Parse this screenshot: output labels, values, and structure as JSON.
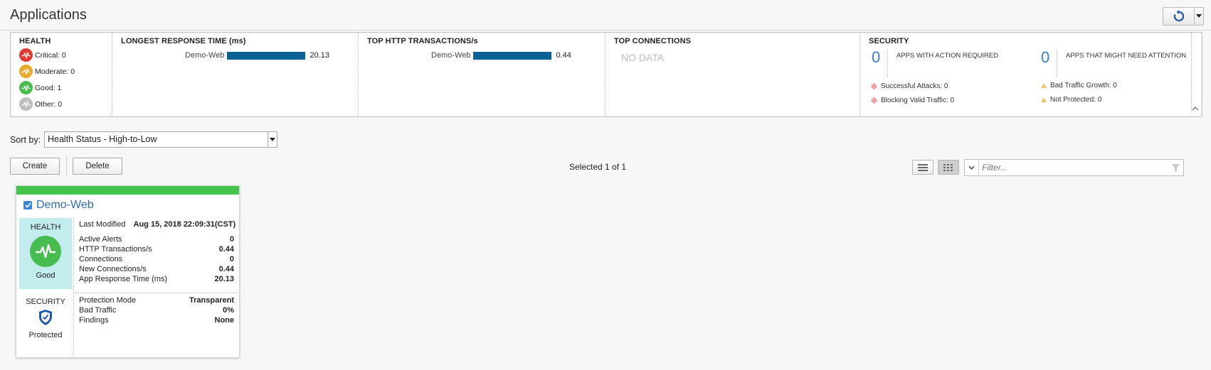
{
  "page": {
    "title": "Applications"
  },
  "summary": {
    "health": {
      "title": "HEALTH",
      "items": [
        {
          "label": "Critical: 0",
          "color": "#e03a33"
        },
        {
          "label": "Moderate: 0",
          "color": "#eaa92a"
        },
        {
          "label": "Good: 1",
          "color": "#47bd4f"
        },
        {
          "label": "Other: 0",
          "color": "#bdbdbd"
        }
      ]
    },
    "response": {
      "title": "LONGEST RESPONSE TIME (ms)",
      "label": "Demo-Web",
      "value": "20.13",
      "fraction": 1.0
    },
    "transactions": {
      "title": "TOP HTTP TRANSACTIONS/s",
      "label": "Demo-Web",
      "value": "0.44",
      "fraction": 1.0
    },
    "connections": {
      "title": "TOP CONNECTIONS",
      "nodata": "NO DATA"
    },
    "security": {
      "title": "SECURITY",
      "action_count": "0",
      "action_label": "APPS WITH ACTION REQUIRED",
      "attention_count": "0",
      "attention_label": "APPS THAT MIGHT NEED ATTENTION",
      "successful_attacks": "Successful Attacks: 0",
      "blocking_valid": "Blocking Valid Traffic: 0",
      "bad_growth": "Bad Traffic Growth: 0",
      "not_protected": "Not Protected: 0"
    }
  },
  "toolbar": {
    "sort_label": "Sort by:",
    "sort_value": "Health Status - High-to-Low",
    "create_label": "Create",
    "delete_label": "Delete",
    "selected_text": "Selected 1 of 1",
    "filter_placeholder": "Filter..."
  },
  "card": {
    "name": "Demo-Web",
    "health_label": "HEALTH",
    "health_status": "Good",
    "security_label": "SECURITY",
    "security_status": "Protected",
    "last_modified_label": "Last Modified",
    "last_modified_value": "Aug 15, 2018 22:09:31(CST)",
    "metrics": [
      {
        "label": "Active Alerts",
        "value": "0"
      },
      {
        "label": "HTTP Transactions/s",
        "value": "0.44"
      },
      {
        "label": "Connections",
        "value": "0"
      },
      {
        "label": "New Connections/s",
        "value": "0.44"
      },
      {
        "label": "App Response Time (ms)",
        "value": "20.13"
      }
    ],
    "security_rows": [
      {
        "label": "Protection Mode",
        "value": "Transparent"
      },
      {
        "label": "Bad Traffic",
        "value": "0%"
      },
      {
        "label": "Findings",
        "value": "None"
      }
    ]
  }
}
